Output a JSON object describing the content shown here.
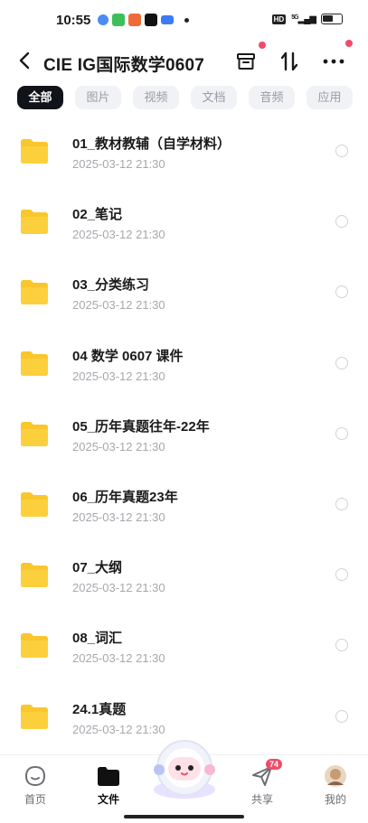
{
  "status_bar": {
    "time": "10:55",
    "network": "HD",
    "signal": "5G"
  },
  "header": {
    "title": "CIE IG国际数学0607"
  },
  "tabs": [
    {
      "label": "全部",
      "active": true
    },
    {
      "label": "图片",
      "active": false
    },
    {
      "label": "视频",
      "active": false
    },
    {
      "label": "文档",
      "active": false
    },
    {
      "label": "音频",
      "active": false
    },
    {
      "label": "应用",
      "active": false
    }
  ],
  "files": [
    {
      "name": "01_教材教辅（自学材料）",
      "date": "2025-03-12  21:30"
    },
    {
      "name": "02_笔记",
      "date": "2025-03-12  21:30"
    },
    {
      "name": "03_分类练习",
      "date": "2025-03-12  21:30"
    },
    {
      "name": "04 数学 0607 课件",
      "date": "2025-03-12  21:30"
    },
    {
      "name": "05_历年真题往年-22年",
      "date": "2025-03-12  21:30"
    },
    {
      "name": "06_历年真题23年",
      "date": "2025-03-12  21:30"
    },
    {
      "name": "07_大纲",
      "date": "2025-03-12  21:30"
    },
    {
      "name": "08_词汇",
      "date": "2025-03-12  21:30"
    },
    {
      "name": "24.1真题",
      "date": "2025-03-12  21:30"
    }
  ],
  "bottom_nav": {
    "home": "首页",
    "files": "文件",
    "share": "共享",
    "share_badge": "74",
    "mine": "我的"
  },
  "colors": {
    "accent_dot": "#ef4c6a",
    "folder": "#f9c62c",
    "active_tab": "#11131a"
  }
}
